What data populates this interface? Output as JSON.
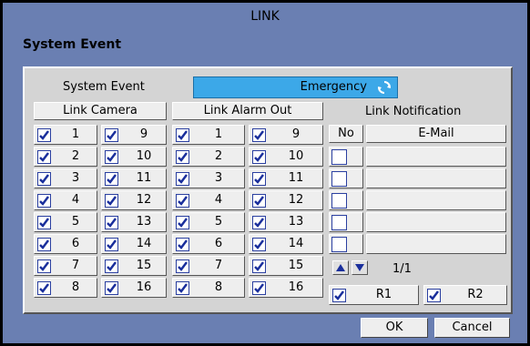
{
  "window": {
    "title": "LINK"
  },
  "section_title": "System Event",
  "event": {
    "label": "System Event",
    "value": "Emergency",
    "refresh_icon": "refresh-icon"
  },
  "link_camera": {
    "header": "Link Camera",
    "left": [
      "1",
      "2",
      "3",
      "4",
      "5",
      "6",
      "7",
      "8"
    ],
    "right": [
      "9",
      "10",
      "11",
      "12",
      "13",
      "14",
      "15",
      "16"
    ]
  },
  "link_alarm_out": {
    "header": "Link Alarm Out",
    "left": [
      "1",
      "2",
      "3",
      "4",
      "5",
      "6",
      "7",
      "8"
    ],
    "right": [
      "9",
      "10",
      "11",
      "12",
      "13",
      "14",
      "15",
      "16"
    ]
  },
  "link_notification": {
    "header": "Link Notification",
    "col_no": "No",
    "col_email": "E-Mail",
    "page": "1/1",
    "r1": "R1",
    "r2": "R2"
  },
  "buttons": {
    "ok": "OK",
    "cancel": "Cancel"
  },
  "colors": {
    "window_bg": "#6a7fb2",
    "panel_bg": "#d4d4d4",
    "select_bg": "#3ca8e8",
    "check": "#1a2f9c"
  }
}
